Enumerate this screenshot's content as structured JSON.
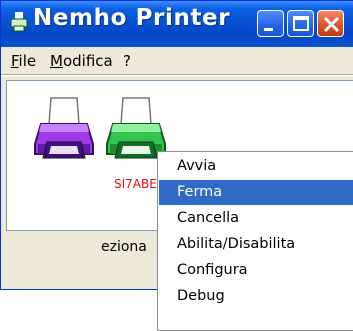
{
  "window": {
    "title": "Nemho Printer"
  },
  "menubar": {
    "items": [
      "File",
      "Modifica",
      "?"
    ]
  },
  "printers": [
    {
      "label": "",
      "color": "#8a2be2"
    },
    {
      "label": "SI7ABE",
      "color": "#22b14c"
    }
  ],
  "statusbar": {
    "text": "eziona"
  },
  "context_menu": {
    "selected": "Ferma",
    "items": [
      "Avvia",
      "Ferma",
      "Cancella",
      "Abilita/Disabilita",
      "Configura",
      "Debug"
    ]
  },
  "colors": {
    "titlebar": "#0655d6",
    "selection": "#316ac5",
    "label_text": "#e01010"
  },
  "icons": {
    "title": "printer-icon",
    "printer1": "printer-icon",
    "printer2": "printer-icon"
  }
}
